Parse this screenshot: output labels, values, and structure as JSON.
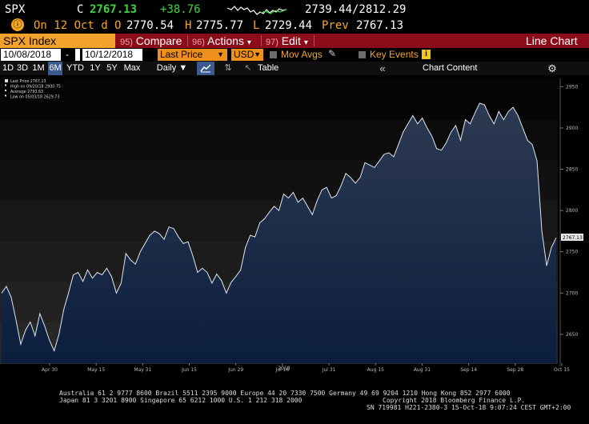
{
  "quote": {
    "ticker": "SPX",
    "close_label": "C",
    "close": "2767.13",
    "change": "+38.76",
    "range": "2739.44/2812.29",
    "icon_label": "ⓘ",
    "date_line": "On 12 Oct d",
    "open_label": "O",
    "open": "2770.54",
    "high_label": "H",
    "high": "2775.77",
    "low_label": "L",
    "low": "2729.44",
    "prev_label": "Prev",
    "prev": "2767.13"
  },
  "menubar": {
    "index_name": "SPX Index",
    "compare_num": "95)",
    "compare": "Compare",
    "actions_num": "96)",
    "actions": "Actions",
    "edit_num": "97)",
    "edit": "Edit",
    "dropdown_glyph": "▾",
    "chart_type": "Line Chart"
  },
  "params": {
    "start_date": "10/08/2018",
    "dash": "-",
    "end_date": "10/12/2018",
    "field": "Last Price",
    "currency": "USD",
    "mov_avgs": "Mov Avgs",
    "key_events": "Key Events"
  },
  "periods": {
    "buttons": [
      "1D",
      "3D",
      "1M",
      "6M",
      "YTD",
      "1Y",
      "5Y",
      "Max"
    ],
    "selected": "6M",
    "frequency": "Daily",
    "table": "Table",
    "chart_content": "Chart Content"
  },
  "chart_data": {
    "type": "area",
    "legend": [
      "Last Price     2767.13",
      "High on 09/20/18  2930.75",
      "Average       2793.63",
      "Low on 05/03/18  2629.73"
    ],
    "last_value_label": "2767.13",
    "x_ticks": [
      "Apr 30",
      "May 15",
      "May 31",
      "Jun 15",
      "Jun 29",
      "Jul 16",
      "Jul 31",
      "Aug 15",
      "Aug 31",
      "Sep 14",
      "Sep 28",
      "Oct 15"
    ],
    "year_label": "2018",
    "y_ticks": [
      "2950",
      "2900",
      "2850",
      "2800",
      "2750",
      "2700",
      "2650"
    ],
    "ylim": [
      2615,
      2960
    ],
    "values": [
      2700,
      2708,
      2695,
      2668,
      2638,
      2655,
      2665,
      2648,
      2675,
      2660,
      2643,
      2630,
      2650,
      2680,
      2700,
      2722,
      2725,
      2714,
      2728,
      2718,
      2725,
      2722,
      2730,
      2720,
      2700,
      2712,
      2748,
      2740,
      2735,
      2750,
      2760,
      2770,
      2775,
      2772,
      2765,
      2780,
      2778,
      2768,
      2760,
      2762,
      2745,
      2725,
      2730,
      2725,
      2712,
      2723,
      2715,
      2700,
      2713,
      2720,
      2728,
      2755,
      2770,
      2768,
      2785,
      2790,
      2798,
      2805,
      2800,
      2820,
      2815,
      2822,
      2810,
      2815,
      2805,
      2795,
      2812,
      2825,
      2828,
      2815,
      2818,
      2830,
      2845,
      2840,
      2833,
      2840,
      2858,
      2855,
      2852,
      2860,
      2868,
      2870,
      2865,
      2880,
      2895,
      2905,
      2915,
      2905,
      2912,
      2900,
      2890,
      2875,
      2873,
      2882,
      2895,
      2903,
      2885,
      2910,
      2905,
      2918,
      2930,
      2928,
      2915,
      2905,
      2920,
      2910,
      2920,
      2925,
      2915,
      2900,
      2885,
      2880,
      2860,
      2775,
      2733,
      2755,
      2767
    ]
  },
  "footer": {
    "line1": "Australia 61 2 9777 8600 Brazil 5511 2395 9000 Europe 44 20 7330 7500 Germany 49 69 9204 1210 Hong Kong 852 2977 6000",
    "line2a": "Japan 81 3 3201 8900       Singapore 65 6212 1000       U.S. 1 212 318 2000",
    "line2b": "Copyright 2018 Bloomberg Finance L.P.",
    "line3": "SN 719981 H221-2380-3 15-Oct-18  9:07:24 CEST GMT+2:00"
  }
}
